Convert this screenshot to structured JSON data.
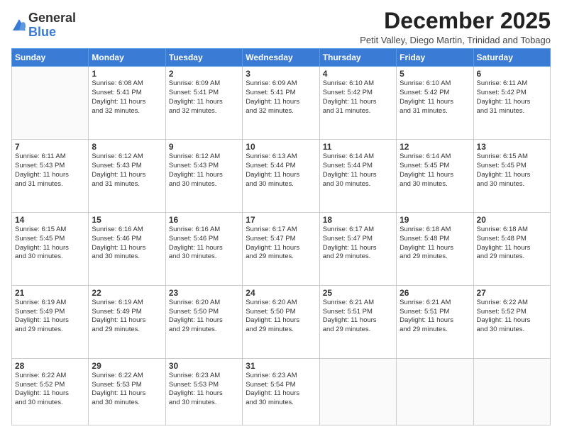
{
  "header": {
    "logo_line1": "General",
    "logo_line2": "Blue",
    "month": "December 2025",
    "location": "Petit Valley, Diego Martin, Trinidad and Tobago"
  },
  "weekdays": [
    "Sunday",
    "Monday",
    "Tuesday",
    "Wednesday",
    "Thursday",
    "Friday",
    "Saturday"
  ],
  "weeks": [
    [
      {
        "day": "",
        "info": ""
      },
      {
        "day": "1",
        "info": "Sunrise: 6:08 AM\nSunset: 5:41 PM\nDaylight: 11 hours\nand 32 minutes."
      },
      {
        "day": "2",
        "info": "Sunrise: 6:09 AM\nSunset: 5:41 PM\nDaylight: 11 hours\nand 32 minutes."
      },
      {
        "day": "3",
        "info": "Sunrise: 6:09 AM\nSunset: 5:41 PM\nDaylight: 11 hours\nand 32 minutes."
      },
      {
        "day": "4",
        "info": "Sunrise: 6:10 AM\nSunset: 5:42 PM\nDaylight: 11 hours\nand 31 minutes."
      },
      {
        "day": "5",
        "info": "Sunrise: 6:10 AM\nSunset: 5:42 PM\nDaylight: 11 hours\nand 31 minutes."
      },
      {
        "day": "6",
        "info": "Sunrise: 6:11 AM\nSunset: 5:42 PM\nDaylight: 11 hours\nand 31 minutes."
      }
    ],
    [
      {
        "day": "7",
        "info": "Sunrise: 6:11 AM\nSunset: 5:43 PM\nDaylight: 11 hours\nand 31 minutes."
      },
      {
        "day": "8",
        "info": "Sunrise: 6:12 AM\nSunset: 5:43 PM\nDaylight: 11 hours\nand 31 minutes."
      },
      {
        "day": "9",
        "info": "Sunrise: 6:12 AM\nSunset: 5:43 PM\nDaylight: 11 hours\nand 30 minutes."
      },
      {
        "day": "10",
        "info": "Sunrise: 6:13 AM\nSunset: 5:44 PM\nDaylight: 11 hours\nand 30 minutes."
      },
      {
        "day": "11",
        "info": "Sunrise: 6:14 AM\nSunset: 5:44 PM\nDaylight: 11 hours\nand 30 minutes."
      },
      {
        "day": "12",
        "info": "Sunrise: 6:14 AM\nSunset: 5:45 PM\nDaylight: 11 hours\nand 30 minutes."
      },
      {
        "day": "13",
        "info": "Sunrise: 6:15 AM\nSunset: 5:45 PM\nDaylight: 11 hours\nand 30 minutes."
      }
    ],
    [
      {
        "day": "14",
        "info": "Sunrise: 6:15 AM\nSunset: 5:45 PM\nDaylight: 11 hours\nand 30 minutes."
      },
      {
        "day": "15",
        "info": "Sunrise: 6:16 AM\nSunset: 5:46 PM\nDaylight: 11 hours\nand 30 minutes."
      },
      {
        "day": "16",
        "info": "Sunrise: 6:16 AM\nSunset: 5:46 PM\nDaylight: 11 hours\nand 30 minutes."
      },
      {
        "day": "17",
        "info": "Sunrise: 6:17 AM\nSunset: 5:47 PM\nDaylight: 11 hours\nand 29 minutes."
      },
      {
        "day": "18",
        "info": "Sunrise: 6:17 AM\nSunset: 5:47 PM\nDaylight: 11 hours\nand 29 minutes."
      },
      {
        "day": "19",
        "info": "Sunrise: 6:18 AM\nSunset: 5:48 PM\nDaylight: 11 hours\nand 29 minutes."
      },
      {
        "day": "20",
        "info": "Sunrise: 6:18 AM\nSunset: 5:48 PM\nDaylight: 11 hours\nand 29 minutes."
      }
    ],
    [
      {
        "day": "21",
        "info": "Sunrise: 6:19 AM\nSunset: 5:49 PM\nDaylight: 11 hours\nand 29 minutes."
      },
      {
        "day": "22",
        "info": "Sunrise: 6:19 AM\nSunset: 5:49 PM\nDaylight: 11 hours\nand 29 minutes."
      },
      {
        "day": "23",
        "info": "Sunrise: 6:20 AM\nSunset: 5:50 PM\nDaylight: 11 hours\nand 29 minutes."
      },
      {
        "day": "24",
        "info": "Sunrise: 6:20 AM\nSunset: 5:50 PM\nDaylight: 11 hours\nand 29 minutes."
      },
      {
        "day": "25",
        "info": "Sunrise: 6:21 AM\nSunset: 5:51 PM\nDaylight: 11 hours\nand 29 minutes."
      },
      {
        "day": "26",
        "info": "Sunrise: 6:21 AM\nSunset: 5:51 PM\nDaylight: 11 hours\nand 29 minutes."
      },
      {
        "day": "27",
        "info": "Sunrise: 6:22 AM\nSunset: 5:52 PM\nDaylight: 11 hours\nand 30 minutes."
      }
    ],
    [
      {
        "day": "28",
        "info": "Sunrise: 6:22 AM\nSunset: 5:52 PM\nDaylight: 11 hours\nand 30 minutes."
      },
      {
        "day": "29",
        "info": "Sunrise: 6:22 AM\nSunset: 5:53 PM\nDaylight: 11 hours\nand 30 minutes."
      },
      {
        "day": "30",
        "info": "Sunrise: 6:23 AM\nSunset: 5:53 PM\nDaylight: 11 hours\nand 30 minutes."
      },
      {
        "day": "31",
        "info": "Sunrise: 6:23 AM\nSunset: 5:54 PM\nDaylight: 11 hours\nand 30 minutes."
      },
      {
        "day": "",
        "info": ""
      },
      {
        "day": "",
        "info": ""
      },
      {
        "day": "",
        "info": ""
      }
    ]
  ]
}
